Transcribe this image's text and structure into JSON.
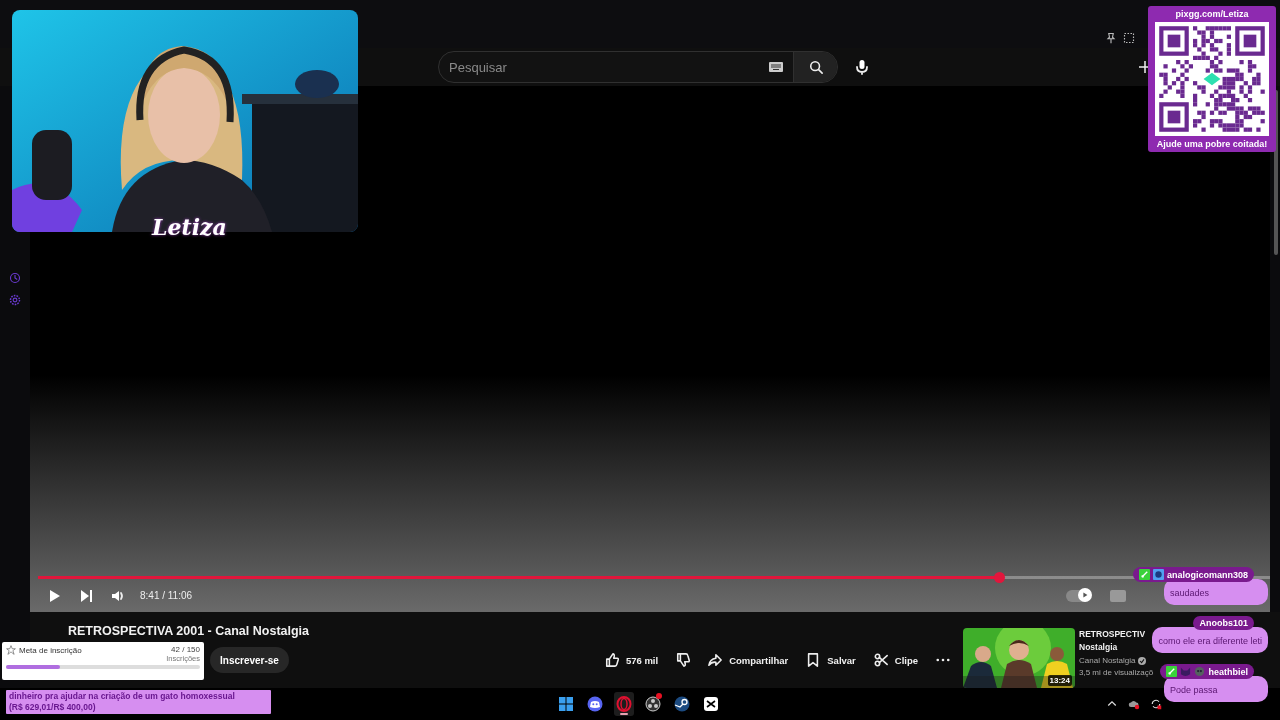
{
  "search": {
    "placeholder": "Pesquisar"
  },
  "video": {
    "progress": {
      "level": 0.78
    },
    "time": "8:41 / 11:06",
    "autoplay_on": true
  },
  "title": "RETROSPECTIVA 2001 - Canal Nostalgia",
  "subscribe_button": "Inscrever-se",
  "actions": [
    {
      "kind": "like",
      "label": "576 mil"
    },
    {
      "kind": "dislike"
    },
    {
      "kind": "share",
      "label": "Compartilhar"
    },
    {
      "kind": "save",
      "label": "Salvar"
    },
    {
      "kind": "clip",
      "label": "Clipe"
    },
    {
      "kind": "more"
    }
  ],
  "recommended": {
    "thumbnail": {
      "kind": "picture"
    },
    "duration": "13:24",
    "title_lines": [
      "RETROSPECTIV",
      "Nostalgia"
    ],
    "channel": "Canal Nostalgia",
    "verified": true,
    "views": "3,5 mi de visualizaçõ"
  },
  "webcam": {
    "kind": "picture",
    "logo": "Letiza"
  },
  "pix_widget": {
    "header": "pixgg.com/Letiza",
    "footer": "Ajude uma pobre coitada!"
  },
  "sub_goal": {
    "label": "Meta de inscrição",
    "count": "42 / 150",
    "unit": "Inscrições",
    "level": 0.28
  },
  "donation_goal": {
    "text": "dinheiro pra ajudar na criação de um gato homoxessual",
    "amount": "(R$ 629,01/R$ 400,00)"
  },
  "chat": [
    {
      "user": "analogicomann308",
      "badges": [
        {
          "kind": "sword"
        },
        {
          "kind": "orb"
        }
      ],
      "text": "saudades"
    },
    {
      "user": "Anoobs101",
      "text": "como ele era diferente leti"
    },
    {
      "user": "heathbiel",
      "badges": [
        {
          "kind": "sword"
        },
        {
          "kind": "cat"
        },
        {
          "kind": "skull"
        }
      ],
      "text": "Pode passa"
    }
  ],
  "taskbar": {
    "apps": [
      {
        "kind": "windows",
        "active": false,
        "alert": false
      },
      {
        "kind": "discord",
        "active": false,
        "alert": false
      },
      {
        "kind": "opera",
        "active": true,
        "alert": false
      },
      {
        "kind": "obs",
        "active": false,
        "alert": true
      },
      {
        "kind": "steam",
        "active": false,
        "alert": false
      },
      {
        "kind": "capcut",
        "active": false,
        "alert": false
      }
    ],
    "tray": [
      {
        "kind": "chevron"
      },
      {
        "kind": "cloud"
      },
      {
        "kind": "sync"
      }
    ]
  }
}
